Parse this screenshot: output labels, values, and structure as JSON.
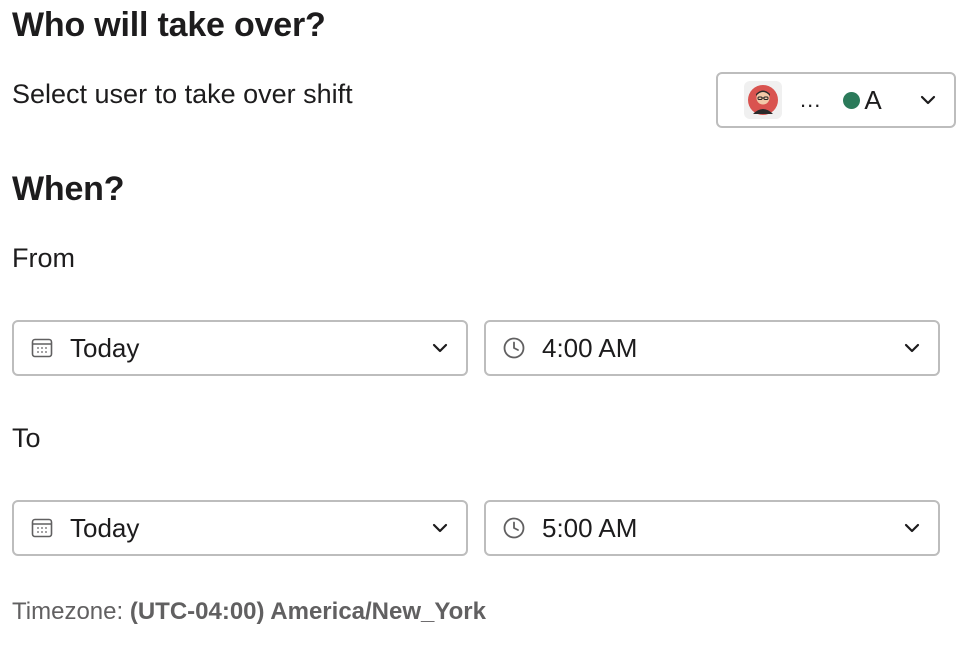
{
  "takeover": {
    "heading": "Who will take over?",
    "prompt": "Select user to take over shift",
    "user_select": {
      "ellipsis": "...",
      "name": "A",
      "presence_color": "#2b7a5a",
      "avatar_icon": "user-avatar"
    }
  },
  "when": {
    "heading": "When?",
    "from": {
      "label": "From",
      "date": "Today",
      "time": "4:00 AM"
    },
    "to": {
      "label": "To",
      "date": "Today",
      "time": "5:00 AM"
    }
  },
  "timezone": {
    "label": "Timezone:",
    "value": "(UTC-04:00) America/New_York"
  }
}
